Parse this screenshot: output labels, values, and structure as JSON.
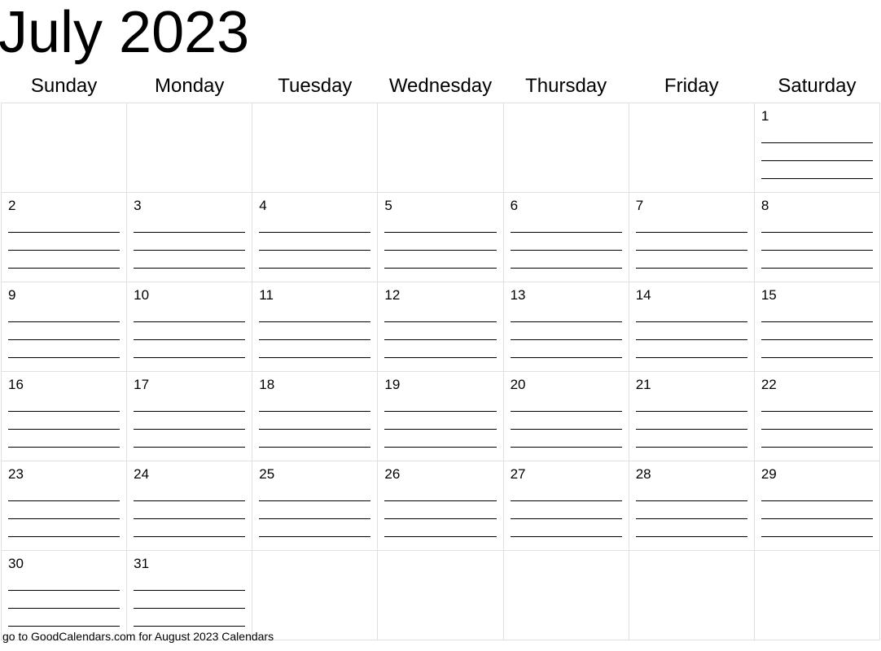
{
  "title": "July 2023",
  "weekdays": [
    "Sunday",
    "Monday",
    "Tuesday",
    "Wednesday",
    "Thursday",
    "Friday",
    "Saturday"
  ],
  "weeks": [
    [
      null,
      null,
      null,
      null,
      null,
      null,
      1
    ],
    [
      2,
      3,
      4,
      5,
      6,
      7,
      8
    ],
    [
      9,
      10,
      11,
      12,
      13,
      14,
      15
    ],
    [
      16,
      17,
      18,
      19,
      20,
      21,
      22
    ],
    [
      23,
      24,
      25,
      26,
      27,
      28,
      29
    ],
    [
      30,
      31,
      null,
      null,
      null,
      null,
      null
    ]
  ],
  "footer": "go to GoodCalendars.com for August 2023 Calendars"
}
